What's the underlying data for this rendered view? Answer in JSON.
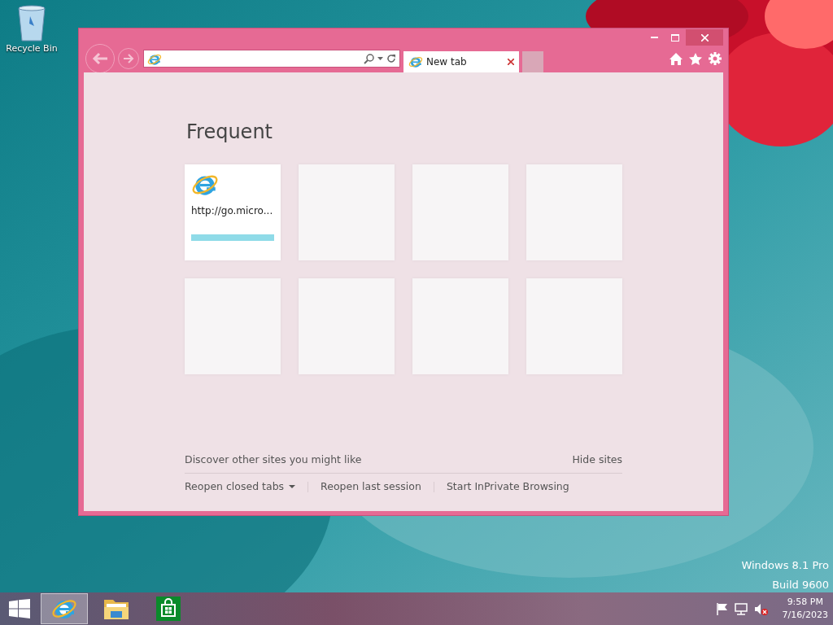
{
  "desktop_icons": [
    {
      "label": "Recycle Bin"
    }
  ],
  "browser": {
    "tab": {
      "label": "New tab",
      "selected": true
    },
    "frequent": {
      "title": "Frequent",
      "tiles": [
        {
          "kind": "site",
          "url": "http://go.micro...",
          "level": 1
        },
        {
          "kind": "empty"
        },
        {
          "kind": "empty"
        },
        {
          "kind": "empty"
        },
        {
          "kind": "empty"
        },
        {
          "kind": "empty"
        },
        {
          "kind": "empty"
        },
        {
          "kind": "empty"
        }
      ]
    },
    "discover": "Discover other sites you might like",
    "hide": "Hide sites",
    "links": [
      {
        "label": "Reopen closed tabs",
        "kind": "dropdown"
      },
      {
        "label": "Reopen last session",
        "kind": "link"
      },
      {
        "label": "Start InPrivate Browsing",
        "kind": "link"
      }
    ]
  },
  "watermark": [
    "Windows 8.1 Pro",
    "Build 9600"
  ],
  "taskbar": {
    "apps": [
      {
        "kind": "ie",
        "selected": true
      },
      {
        "kind": "explorer",
        "selected": false
      },
      {
        "kind": "store",
        "selected": false
      }
    ],
    "volume_muted": true,
    "time": "9:58 PM",
    "date": "7/16/2023"
  }
}
